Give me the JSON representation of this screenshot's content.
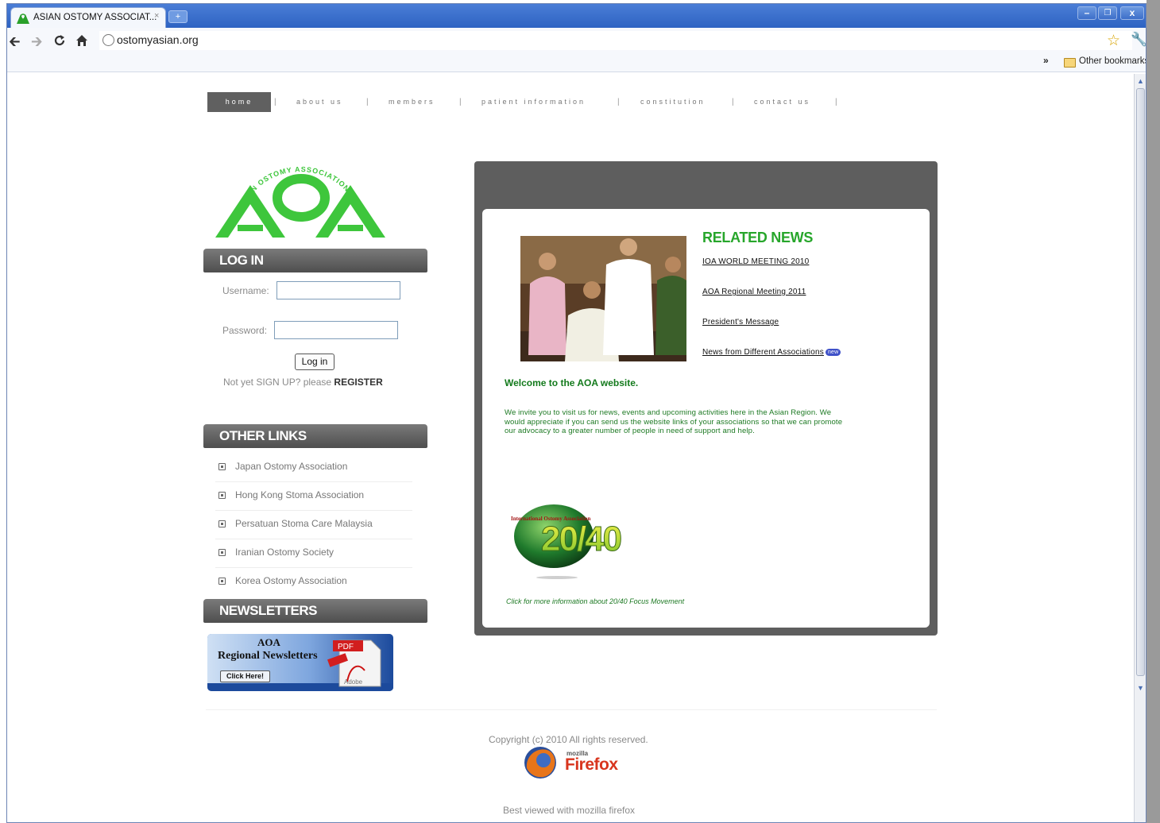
{
  "browser": {
    "tab_title": "ASIAN OSTOMY ASSOCIAT...",
    "tab_close": "×",
    "new_tab": "+",
    "url": "ostomyasian.org",
    "bookmarks_chevron": "»",
    "bookmarks_folder": "Other bookmarks",
    "window_buttons": {
      "minimize": "–",
      "restore": "❐",
      "close": "x"
    }
  },
  "nav": {
    "items": [
      "home",
      "about us",
      "members",
      "patient information",
      "constitution",
      "contact us"
    ],
    "separator": "|",
    "active": "home"
  },
  "logo": {
    "text": "AOA",
    "arc_text": "ASIAN OSTOMY ASSOCIATION",
    "color": "#3ec63c"
  },
  "login": {
    "header": "LOG IN",
    "username_label": "Username:",
    "password_label": "Password:",
    "button": "Log in",
    "signup_text": "Not yet SIGN UP? please",
    "register_link": "REGISTER"
  },
  "other_links": {
    "header": "OTHER LINKS",
    "items": [
      "Japan Ostomy Association",
      "Hong Kong Stoma Association",
      "Persatuan Stoma Care Malaysia",
      "Iranian Ostomy Society",
      "Korea Ostomy Association"
    ]
  },
  "newsletters": {
    "header": "NEWSLETTERS",
    "banner_aoa": "AOA",
    "banner_title": "Regional Newsletters",
    "banner_button": "Click Here!",
    "pdf_label": "PDF",
    "adobe_label": "Adobe"
  },
  "main": {
    "related_news_title": "RELATED NEWS",
    "related_news": [
      "IOA WORLD MEETING 2010",
      "AOA Regional Meeting 2011",
      "President's Message",
      "News from Different Associations"
    ],
    "new_badge": "new",
    "welcome": "Welcome to the AOA website.",
    "intro_lines": [
      "We invite you to visit us for news, events and upcoming activities here in the Asian Region. We",
      "would appreciate if you can send us the website links of your associations so that we can promote",
      "our advocacy to a greater number of people in need of support and help."
    ],
    "logo_2040_text": "20/40",
    "logo_2040_arc": "International Ostomy Association",
    "logo_2040_caption": "Click for more information about 20/40 Focus Movement"
  },
  "footer": {
    "copyright": "Copyright (c) 2010 All rights reserved.",
    "firefox_small": "mozilla",
    "firefox_brand": "Firefox",
    "best_viewed": "Best viewed with mozilla firefox"
  },
  "colors": {
    "accent_green": "#27a62b",
    "nav_active_bg": "#606060",
    "panel_gray": "#5e5e5e",
    "chrome_blue": "#2e63c2"
  }
}
